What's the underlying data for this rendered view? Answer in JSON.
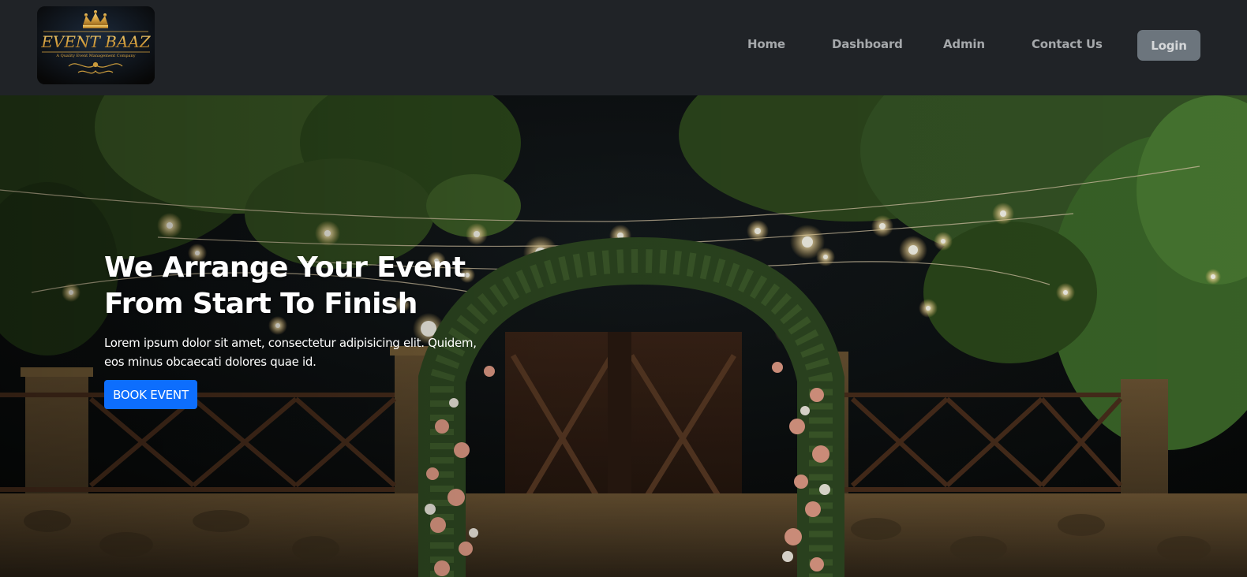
{
  "brand": {
    "name": "EVENT BAAZ",
    "tagline": "A Quality Event Management Company",
    "logo_icon": "crown-icon",
    "colors": {
      "gold": "#d9a441",
      "dark": "#0a0a0a"
    }
  },
  "nav": {
    "items": [
      {
        "label": "Home"
      },
      {
        "label": "Dashboard"
      },
      {
        "label": "Admin"
      },
      {
        "label": "Contact Us"
      }
    ],
    "login_label": "Login"
  },
  "hero": {
    "title_line1": "We Arrange Your Event",
    "title_line2": "From Start To Finish",
    "description": "Lorem ipsum dolor sit amet, consectetur adipisicing elit. Quidem, eos minus obcaecati dolores quae id.",
    "cta_label": "BOOK EVENT"
  },
  "colors": {
    "navbar_bg": "#202327",
    "nav_text": "#a5a8ab",
    "login_bg": "#6c757d",
    "cta_bg": "#0d6efd"
  }
}
